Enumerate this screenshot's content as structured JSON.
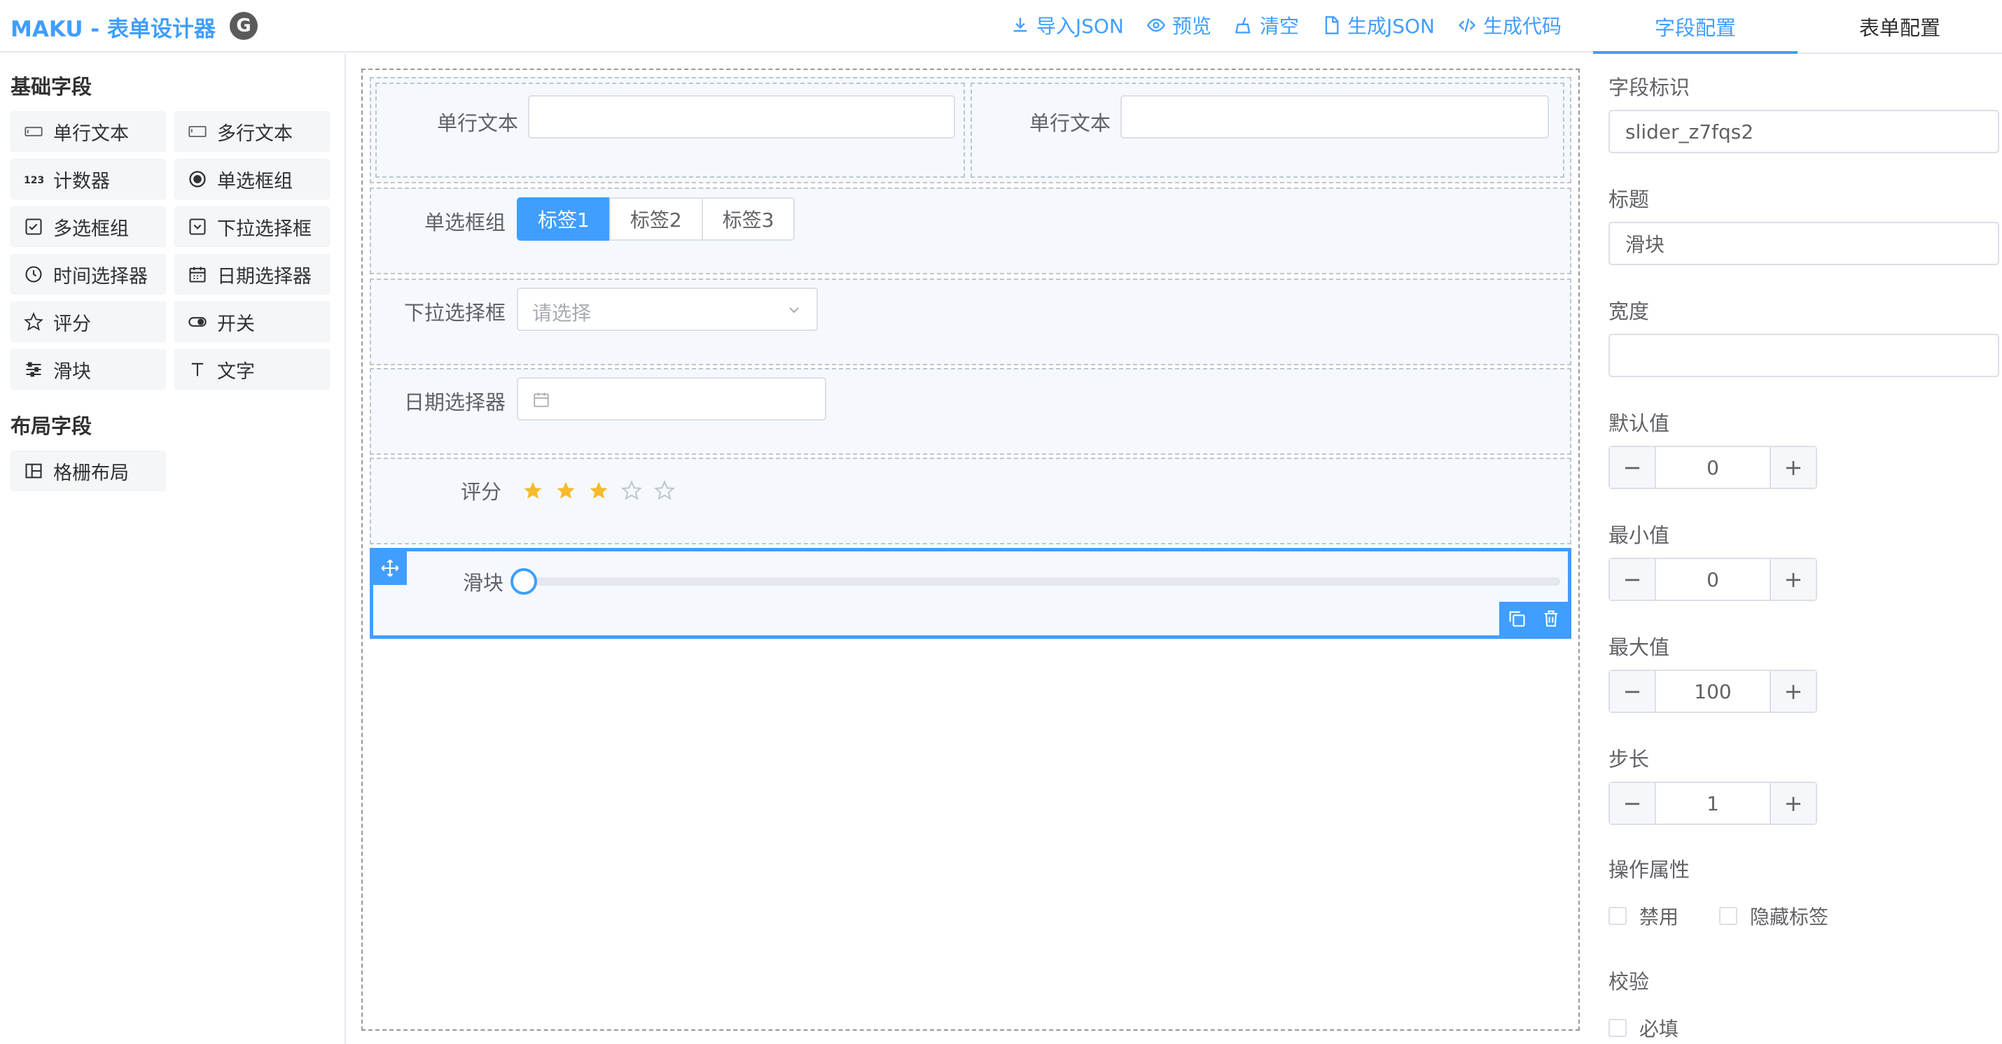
{
  "header": {
    "brand": "MAKU - 表单设计器",
    "logo_letter": "G",
    "toolbar": [
      {
        "icon": "download-icon",
        "label": "导入JSON"
      },
      {
        "icon": "eye-icon",
        "label": "预览"
      },
      {
        "icon": "broom-icon",
        "label": "清空"
      },
      {
        "icon": "file-json-icon",
        "label": "生成JSON"
      },
      {
        "icon": "code-icon",
        "label": "生成代码"
      }
    ]
  },
  "right_tabs": [
    {
      "label": "字段配置",
      "active": true
    },
    {
      "label": "表单配置",
      "active": false
    }
  ],
  "palette": {
    "basic_title": "基础字段",
    "basic_items": [
      {
        "icon": "input-icon",
        "label": "单行文本"
      },
      {
        "icon": "textarea-icon",
        "label": "多行文本"
      },
      {
        "icon": "number-icon",
        "label": "计数器"
      },
      {
        "icon": "radio-icon",
        "label": "单选框组"
      },
      {
        "icon": "checkbox-icon",
        "label": "多选框组"
      },
      {
        "icon": "select-icon",
        "label": "下拉选择框"
      },
      {
        "icon": "clock-icon",
        "label": "时间选择器"
      },
      {
        "icon": "calendar-icon",
        "label": "日期选择器"
      },
      {
        "icon": "star-icon",
        "label": "评分"
      },
      {
        "icon": "switch-icon",
        "label": "开关"
      },
      {
        "icon": "slider-icon",
        "label": "滑块"
      },
      {
        "icon": "text-icon",
        "label": "文字"
      }
    ],
    "layout_title": "布局字段",
    "layout_items": [
      {
        "icon": "grid-icon",
        "label": "格栅布局"
      }
    ]
  },
  "form": {
    "grid_col1_label": "单行文本",
    "grid_col2_label": "单行文本",
    "radio_label": "单选框组",
    "radio_options": [
      "标签1",
      "标签2",
      "标签3"
    ],
    "radio_selected": "标签1",
    "select_label": "下拉选择框",
    "select_placeholder": "请选择",
    "date_label": "日期选择器",
    "rate_label": "评分",
    "rate_value": 3,
    "rate_max": 5,
    "slider_label": "滑块",
    "slider_value": 0
  },
  "config": {
    "field_id_label": "字段标识",
    "field_id_value": "slider_z7fqs2",
    "title_label": "标题",
    "title_value": "滑块",
    "width_label": "宽度",
    "width_value": "",
    "default_label": "默认值",
    "default_value": "0",
    "min_label": "最小值",
    "min_value": "0",
    "max_label": "最大值",
    "max_value": "100",
    "step_label": "步长",
    "step_value": "1",
    "ops_label": "操作属性",
    "disabled_label": "禁用",
    "hide_label_label": "隐藏标签",
    "validate_label": "校验",
    "required_label": "必填",
    "minus_symbol": "−",
    "plus_symbol": "+"
  },
  "colors": {
    "primary": "#409eff",
    "star_active": "#f7ba2a",
    "star_inactive": "#c0c4cc"
  }
}
